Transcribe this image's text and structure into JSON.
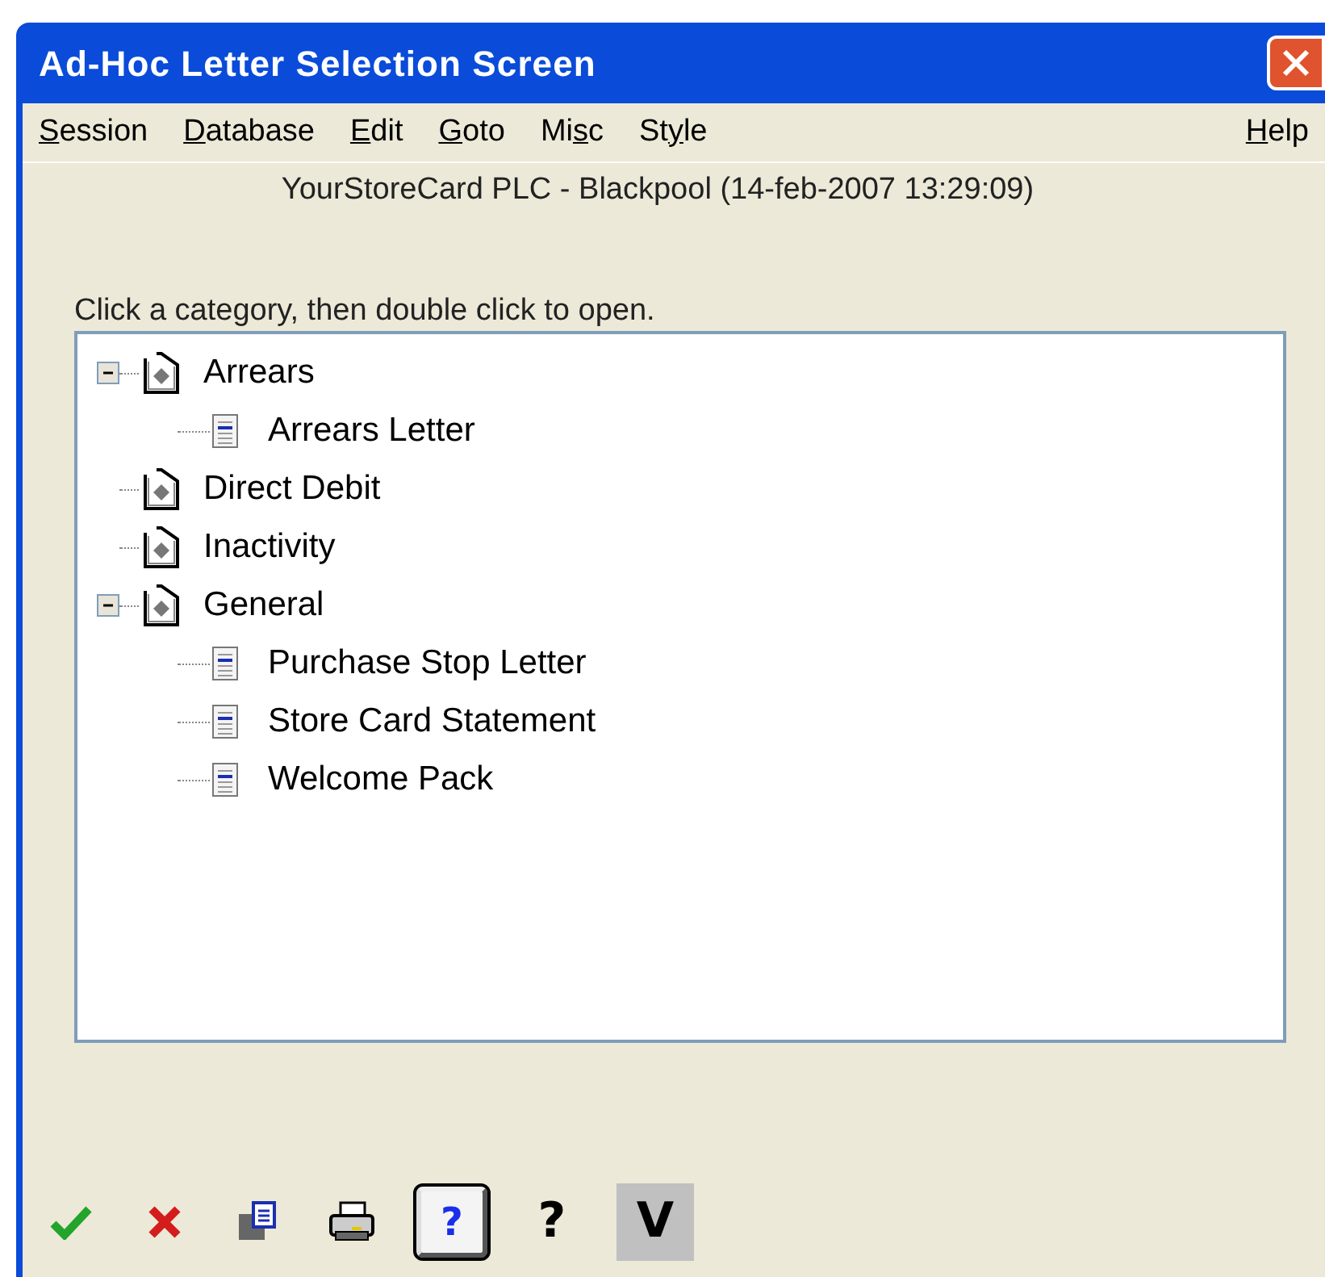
{
  "window": {
    "title": "Ad-Hoc Letter Selection Screen"
  },
  "menu": [
    {
      "key": "S",
      "post": "ession"
    },
    {
      "key": "D",
      "post": "atabase"
    },
    {
      "key": "E",
      "post": "dit"
    },
    {
      "key": "G",
      "post": "oto"
    },
    {
      "pre": "Mi",
      "key": "s",
      "post": "c"
    },
    {
      "pre": "St",
      "key": "y",
      "post": "le"
    }
  ],
  "help_menu": {
    "key": "H",
    "post": "elp"
  },
  "header": "YourStoreCard PLC - Blackpool (14-feb-2007 13:29:09)",
  "instruction": "Click a category, then double click to open.",
  "tree": [
    {
      "label": "Arrears",
      "expanded": true,
      "children": [
        {
          "label": "Arrears Letter"
        }
      ]
    },
    {
      "label": "Direct Debit"
    },
    {
      "label": "Inactivity"
    },
    {
      "label": "General",
      "expanded": true,
      "children": [
        {
          "label": "Purchase Stop Letter"
        },
        {
          "label": "Store Card Statement"
        },
        {
          "label": "Welcome Pack"
        }
      ]
    }
  ],
  "toolbar": [
    {
      "kind": "ok"
    },
    {
      "kind": "cancel"
    },
    {
      "kind": "copy"
    },
    {
      "kind": "print"
    },
    {
      "kind": "help_box",
      "text": "?"
    },
    {
      "kind": "question",
      "text": "?"
    },
    {
      "kind": "version",
      "text": "V"
    }
  ]
}
